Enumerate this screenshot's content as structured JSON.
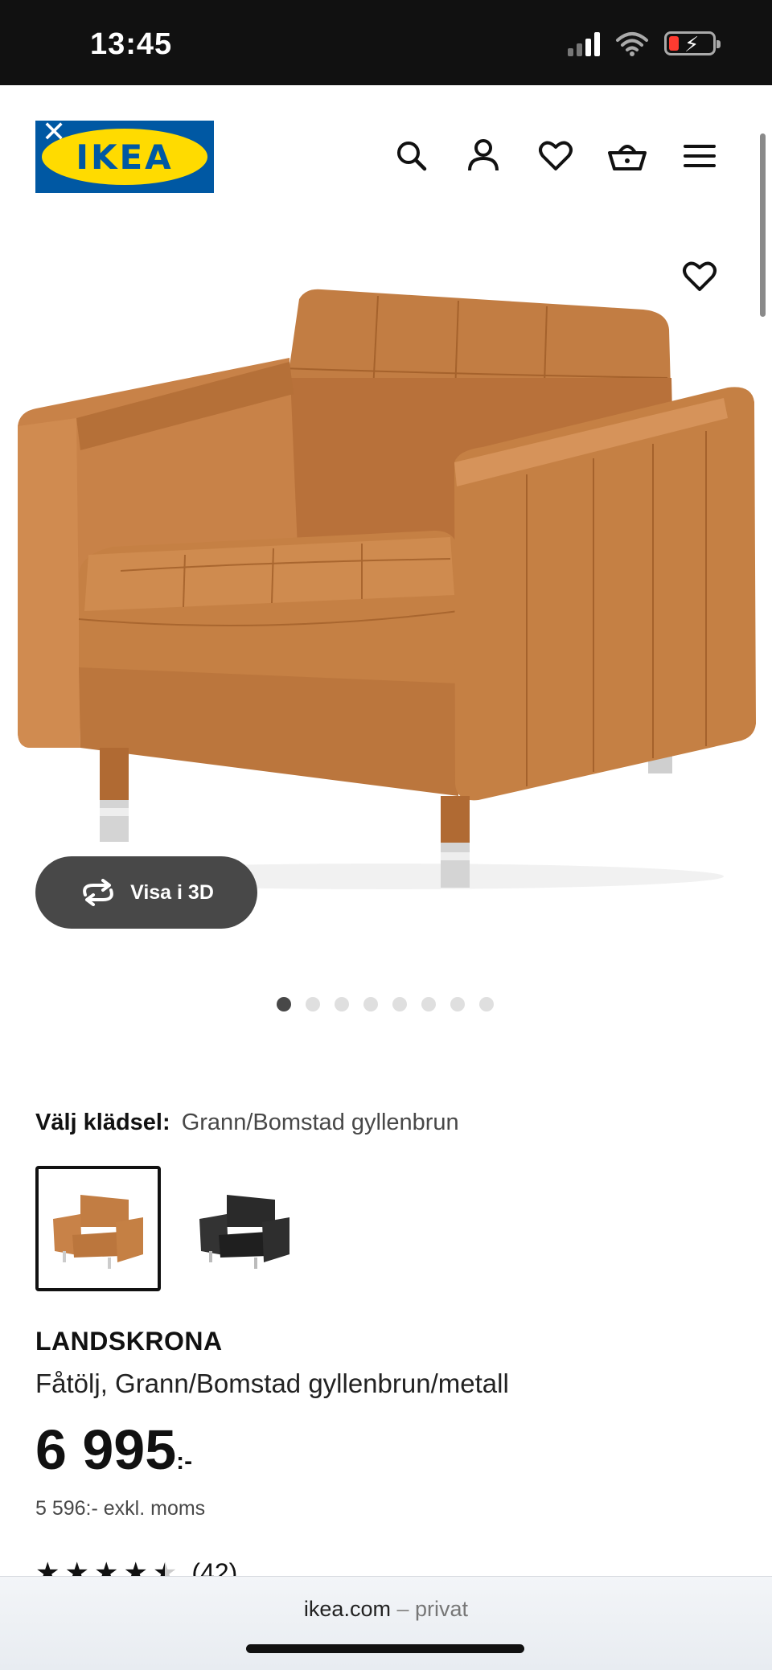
{
  "status_bar": {
    "time": "13:45"
  },
  "header": {
    "logo_text": "IKEA",
    "icons": [
      "search-icon",
      "user-icon",
      "heart-icon",
      "cart-icon",
      "menu-icon"
    ]
  },
  "gallery": {
    "view_3d_label": "Visa i 3D",
    "slide_count": 8,
    "active_slide": 1
  },
  "upholstery": {
    "label": "Välj klädsel:",
    "value": "Grann/Bomstad gyllenbrun",
    "options": [
      "Grann/Bomstad gyllenbrun",
      "black leather"
    ]
  },
  "product": {
    "name": "LANDSKRONA",
    "description": "Fåtölj, Grann/Bomstad gyllenbrun/metall",
    "price": "6 995",
    "price_suffix": ":-",
    "price_excl": "5 596:- exkl. moms",
    "rating_stars": 4.5,
    "rating_count": "(42)"
  },
  "browser": {
    "domain": "ikea.com",
    "separator": "–",
    "mode": "privat"
  },
  "colors": {
    "ikea_blue": "#0058a3",
    "ikea_yellow": "#ffdb00",
    "chair_leather": "#c07a40",
    "button_dark": "#484848"
  }
}
